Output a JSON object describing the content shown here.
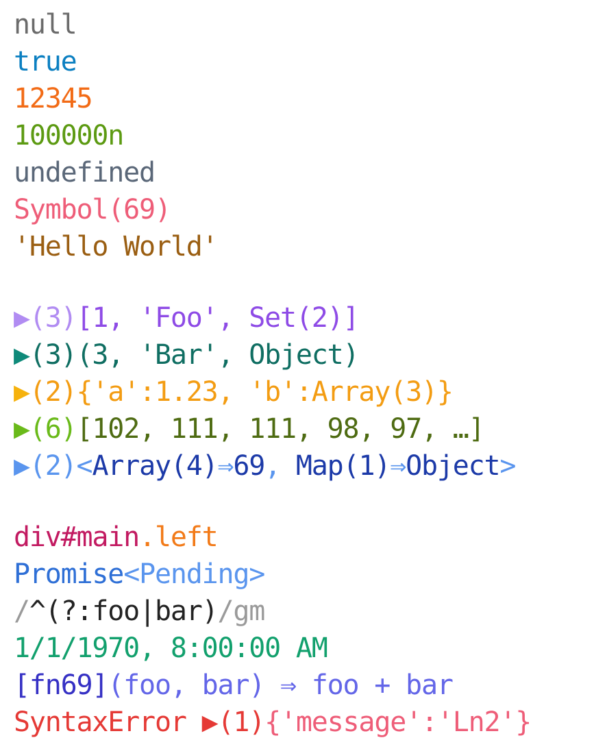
{
  "primitives": {
    "null": "null",
    "boolean": "true",
    "number": "12345",
    "bigint": "100000n",
    "undefined": "undefined",
    "symbol": "Symbol(69)",
    "string": "'Hello World'"
  },
  "collections": {
    "expand_icon": "play-triangle-icon",
    "array": {
      "meta": "(3)",
      "body": "[1, 'Foo', Set(2)]"
    },
    "tuple": {
      "meta": "(3)",
      "body": "(3, 'Bar', Object)"
    },
    "object": {
      "meta": "(2)",
      "body": "{'a':1.23, 'b':Array(3)}"
    },
    "buffer": {
      "meta": "(6)",
      "body": "[102, 111, 111, 98, 97, …]"
    },
    "map": {
      "meta": "(2)",
      "open": "<",
      "k1": "Array(4)",
      "arrow": "⇒",
      "v1": "69",
      "sep": ", ",
      "k2": "Map(1)",
      "v2": "Object",
      "close": ">"
    }
  },
  "misc": {
    "element": {
      "tag": "div#main",
      "cls": ".left"
    },
    "promise": {
      "name": "Promise",
      "state": "<Pending>"
    },
    "regex": {
      "open": "/",
      "body": "^(?:foo|bar)",
      "close": "/",
      "flags": "gm"
    },
    "date": "1/1/1970, 8:00:00 AM",
    "function": {
      "name": "[fn69]",
      "sig": "(foo, bar) ⇒ foo + bar"
    },
    "error": {
      "name": "SyntaxError ",
      "meta": "(1)",
      "body": "{'message':'Ln2'}"
    }
  },
  "colors": {
    "array": "#8e4be6",
    "tuple": "#0f6e62",
    "object": "#f39c12",
    "buffer": "#4e6b12",
    "map": "#1c3aa8",
    "error": "#e53935"
  }
}
